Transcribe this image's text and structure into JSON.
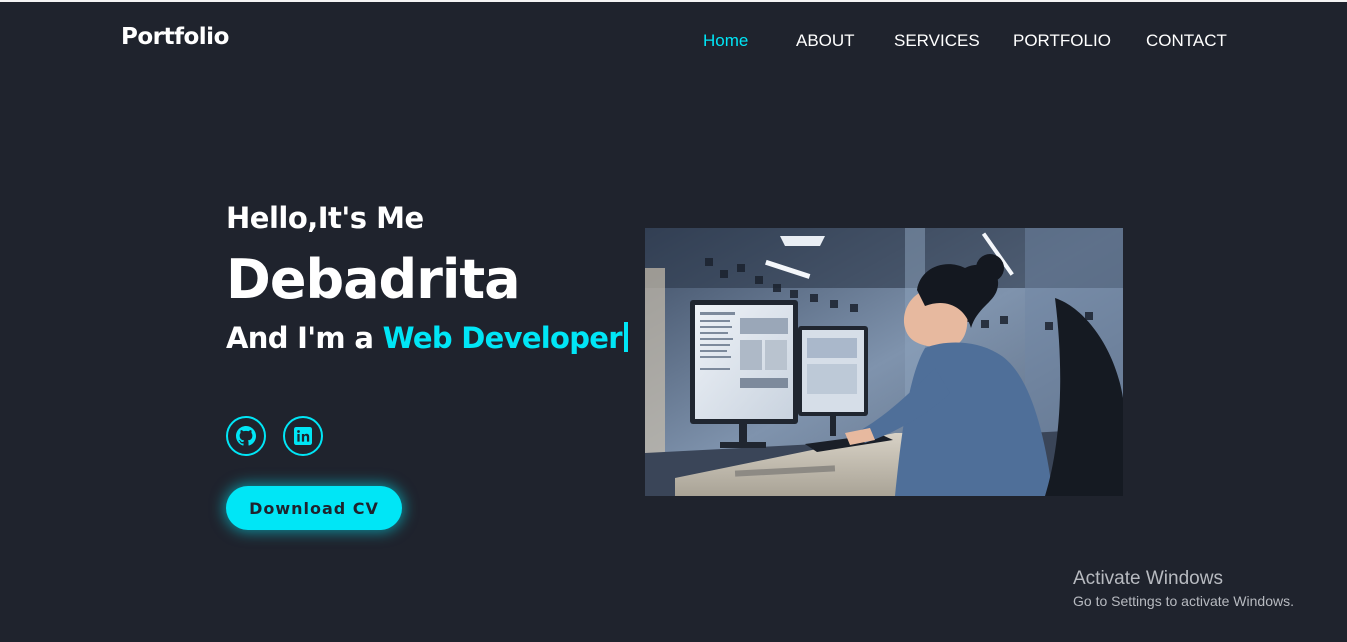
{
  "nav": {
    "logo": "Portfolio",
    "links": [
      "Home",
      "ABOUT",
      "SERVICES",
      "PORTFOLIO",
      "CONTACT"
    ],
    "active_index": 0
  },
  "hero": {
    "greeting": "Hello,It's Me",
    "name": "Debadrita",
    "role_prefix": "And I'm a ",
    "role": "Web Developer",
    "cv_button": "Download CV",
    "socials": [
      {
        "icon": "github-icon"
      },
      {
        "icon": "linkedin-icon"
      }
    ]
  },
  "watermark": {
    "title": "Activate Windows",
    "subtitle": "Go to Settings to activate Windows."
  },
  "colors": {
    "background": "#1f232d",
    "accent": "#00e6f6",
    "text": "#ffffff"
  }
}
